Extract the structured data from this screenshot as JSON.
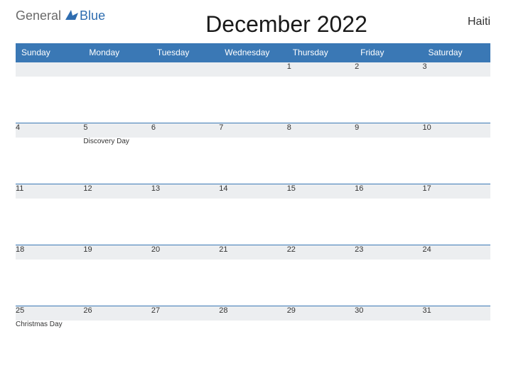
{
  "header": {
    "logo_part1": "General",
    "logo_part2": "Blue",
    "title": "December 2022",
    "country": "Haiti"
  },
  "days": [
    "Sunday",
    "Monday",
    "Tuesday",
    "Wednesday",
    "Thursday",
    "Friday",
    "Saturday"
  ],
  "weeks": [
    {
      "nums": [
        "",
        "",
        "",
        "",
        "1",
        "2",
        "3"
      ],
      "events": [
        "",
        "",
        "",
        "",
        "",
        "",
        ""
      ]
    },
    {
      "nums": [
        "4",
        "5",
        "6",
        "7",
        "8",
        "9",
        "10"
      ],
      "events": [
        "",
        "Discovery Day",
        "",
        "",
        "",
        "",
        ""
      ]
    },
    {
      "nums": [
        "11",
        "12",
        "13",
        "14",
        "15",
        "16",
        "17"
      ],
      "events": [
        "",
        "",
        "",
        "",
        "",
        "",
        ""
      ]
    },
    {
      "nums": [
        "18",
        "19",
        "20",
        "21",
        "22",
        "23",
        "24"
      ],
      "events": [
        "",
        "",
        "",
        "",
        "",
        "",
        ""
      ]
    },
    {
      "nums": [
        "25",
        "26",
        "27",
        "28",
        "29",
        "30",
        "31"
      ],
      "events": [
        "Christmas Day",
        "",
        "",
        "",
        "",
        "",
        ""
      ]
    }
  ]
}
